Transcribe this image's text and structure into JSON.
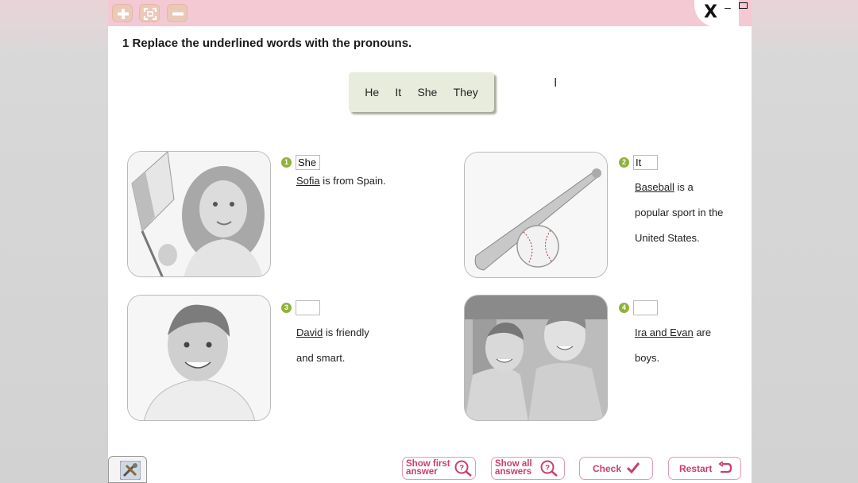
{
  "toolbar": {
    "zoom_in_icon": "plus-icon",
    "fit_icon": "fullscreen-icon",
    "zoom_out_icon": "minus-icon",
    "close_label": "X",
    "colors": {
      "bar": "#f4c9d3",
      "accent": "#c9406b",
      "number": "#8fb23c"
    }
  },
  "instruction": "1 Replace the underlined words with the pronouns.",
  "word_bank": [
    "He",
    "It",
    "She",
    "They"
  ],
  "items": [
    {
      "number": "1",
      "answer": "She",
      "underlined": "Sofia",
      "line1_rest": " is from Spain.",
      "extra_lines": []
    },
    {
      "number": "2",
      "answer": "It",
      "underlined": "Baseball",
      "line1_rest": " is a",
      "extra_lines": [
        "popular sport in the",
        "United States."
      ]
    },
    {
      "number": "3",
      "answer": "",
      "underlined": "David",
      "line1_rest": " is friendly",
      "extra_lines": [
        "and smart."
      ]
    },
    {
      "number": "4",
      "answer": "",
      "underlined": "Ira and Evan",
      "line1_rest": " are",
      "extra_lines": [
        "boys."
      ]
    }
  ],
  "footer": {
    "tools_label": "i-tools",
    "show_first": [
      "Show first",
      "answer"
    ],
    "show_all": [
      "Show all",
      "answers"
    ],
    "check": "Check",
    "restart": "Restart"
  }
}
